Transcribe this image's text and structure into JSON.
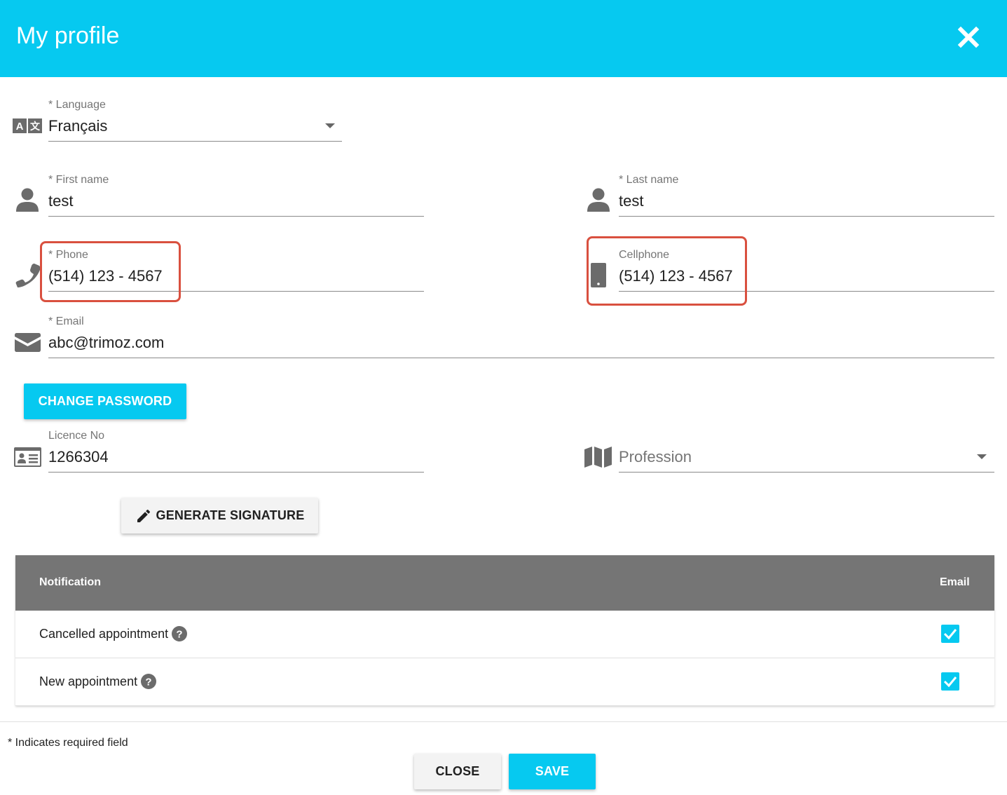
{
  "header": {
    "title": "My profile",
    "close_icon": "close-icon",
    "bg_color": "#06c9f0"
  },
  "language": {
    "label": "* Language",
    "value": "Français",
    "icon": "translate-icon"
  },
  "first_name": {
    "label": "* First name",
    "value": "test",
    "icon": "person-icon"
  },
  "last_name": {
    "label": "* Last name",
    "value": "test",
    "icon": "person-icon"
  },
  "phone": {
    "label": "* Phone",
    "value": "(514) 123 - 4567",
    "icon": "phone-icon"
  },
  "cellphone": {
    "label": "Cellphone",
    "value": "(514) 123 - 4567",
    "icon": "mobile-icon"
  },
  "email": {
    "label": "* Email",
    "value": "abc@trimoz.com",
    "icon": "envelope-icon"
  },
  "change_password": {
    "label": "CHANGE PASSWORD"
  },
  "licence": {
    "label": "Licence No",
    "value": "1266304",
    "icon": "id-card-icon"
  },
  "profession": {
    "placeholder": "Profession",
    "icon": "map-icon"
  },
  "generate_signature": {
    "label": "GENERATE SIGNATURE",
    "icon": "pencil-icon"
  },
  "notifications": {
    "headers": {
      "notification": "Notification",
      "email": "Email"
    },
    "rows": [
      {
        "label": "Cancelled appointment",
        "email_checked": true
      },
      {
        "label": "New appointment",
        "email_checked": true
      }
    ]
  },
  "footer": {
    "required_note": "* Indicates required field",
    "close_label": "CLOSE",
    "save_label": "SAVE"
  },
  "colors": {
    "accent": "#06c9f0",
    "highlight": "#d9503f",
    "table_header": "#757575"
  }
}
